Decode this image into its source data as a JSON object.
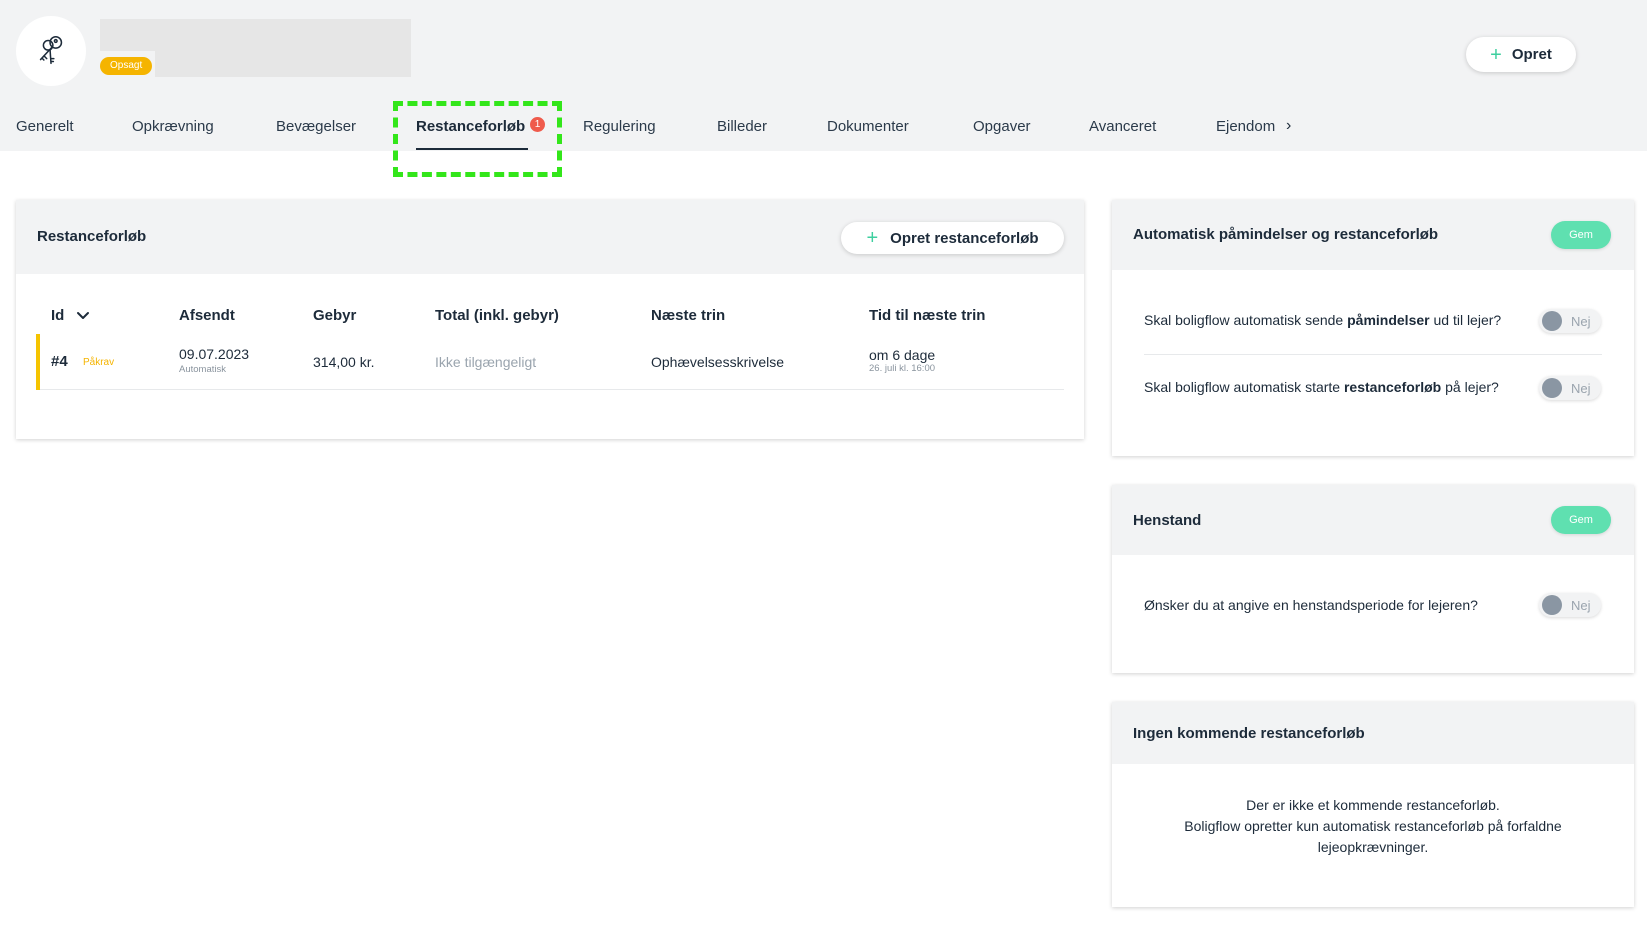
{
  "header": {
    "status_badge": "Opsagt",
    "create_label": "Opret"
  },
  "tabs": [
    {
      "label": "Generelt"
    },
    {
      "label": "Opkrævning"
    },
    {
      "label": "Bevægelser"
    },
    {
      "label": "Restanceforløb",
      "badge": "1",
      "active": true
    },
    {
      "label": "Regulering"
    },
    {
      "label": "Billeder"
    },
    {
      "label": "Dokumenter"
    },
    {
      "label": "Opgaver"
    },
    {
      "label": "Avanceret"
    },
    {
      "label": "Ejendom"
    }
  ],
  "arrears": {
    "title": "Restanceforløb",
    "create_label": "Opret restanceforløb",
    "columns": [
      "Id",
      "Afsendt",
      "Gebyr",
      "Total (inkl. gebyr)",
      "Næste trin",
      "Tid til næste trin"
    ],
    "rows": [
      {
        "id": "#4",
        "type": "Påkrav",
        "sent": "09.07.2023",
        "sent_sub": "Automatisk",
        "fee": "314,00 kr.",
        "total": "Ikke tilgængeligt",
        "next_step": "Ophævelsesskrivelse",
        "time_to_next": "om 6 dage",
        "time_to_next_sub": "26. juli kl. 16:00"
      }
    ]
  },
  "auto_reminders": {
    "title": "Automatisk påmindelser og restanceforløb",
    "save_label": "Gem",
    "q1": {
      "pre": "Skal boligflow automatisk sende ",
      "bold": "påmindelser",
      "post": " ud til lejer?",
      "value": "Nej"
    },
    "q2": {
      "pre": "Skal boligflow automatisk starte ",
      "bold": "restanceforløb",
      "post": " på lejer?",
      "value": "Nej"
    }
  },
  "deferment": {
    "title": "Henstand",
    "save_label": "Gem",
    "question": "Ønsker du at angive en henstandsperiode for lejeren?",
    "value": "Nej"
  },
  "upcoming": {
    "title": "Ingen kommende restanceforløb",
    "line1": "Der er ikke et kommende restanceforløb.",
    "line2": "Boligflow opretter kun automatisk restanceforløb på forfaldne",
    "line3": "lejeopkrævninger."
  },
  "colors": {
    "accent_green": "#5fe0b0",
    "status_yellow": "#f5b400",
    "notification_red": "#ef5b4c",
    "highlight_green": "#33e61a"
  }
}
